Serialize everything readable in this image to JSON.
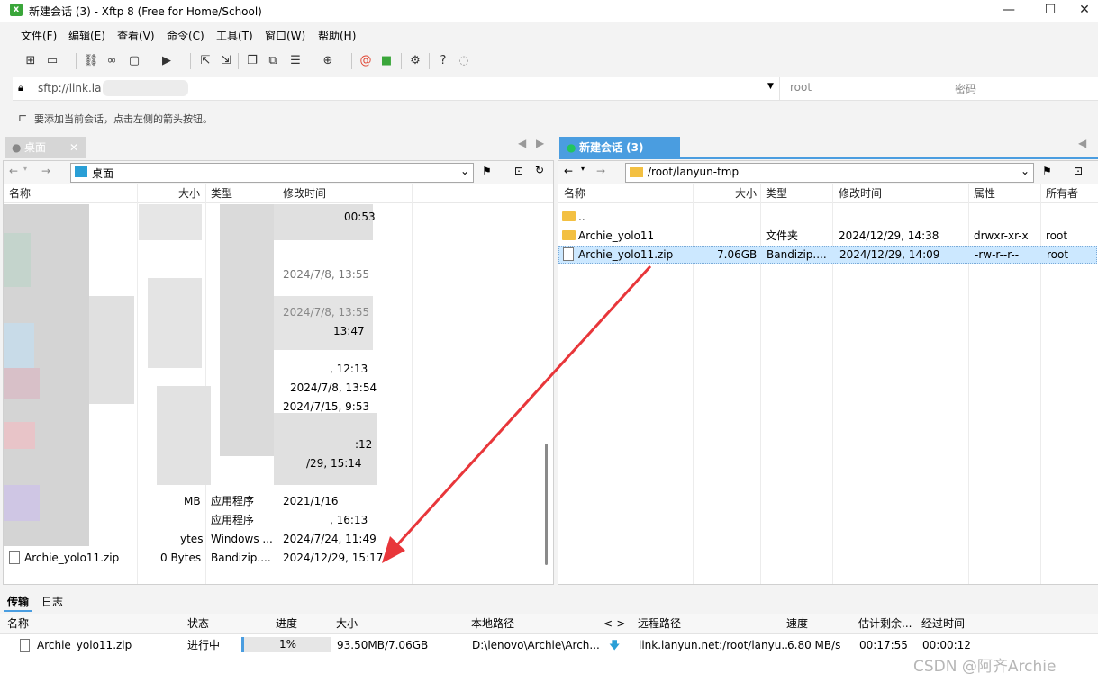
{
  "window": {
    "title": "新建会话 (3) - Xftp 8 (Free for Home/School)",
    "app_icon": "xftp-icon"
  },
  "menu": [
    "文件(F)",
    "编辑(E)",
    "查看(V)",
    "命令(C)",
    "工具(T)",
    "窗口(W)",
    "帮助(H)"
  ],
  "address": {
    "url": "sftp://link.la",
    "user_placeholder": "root",
    "password_placeholder": "密码"
  },
  "info_text": "要添加当前会话，点击左侧的箭头按钮。",
  "left_pane": {
    "tab_label": "桌面",
    "path": "桌面",
    "columns": [
      "名称",
      "大小",
      "类型",
      "修改时间"
    ],
    "visible_fragments": {
      "t1": "00:53",
      "t2": "2024/7/8, 13:55",
      "t3": "2024/7/8, 13:55",
      "t4": "13:47",
      "t5": ", 12:13",
      "t6": "2024/7/8, 13:54",
      "t7": "2024/7/15, 9:53",
      "t8": ":12",
      "t9": "/29, 15:14",
      "s1": "MB",
      "type1": "应用程序",
      "d1": "2021/1/16",
      "type2": "应用程序",
      "d2": ", 16:13",
      "s2": "ytes",
      "type3": "Windows ...",
      "d3": "2024/7/24, 11:49"
    },
    "rows": [
      {
        "name": "Archie_yolo11.zip",
        "size": "0 Bytes",
        "type": "Bandizip....",
        "modified": "2024/12/29, 15:17"
      }
    ]
  },
  "right_pane": {
    "tab_label": "新建会话 (3)",
    "path": "/root/lanyun-tmp",
    "columns": [
      "名称",
      "大小",
      "类型",
      "修改时间",
      "属性",
      "所有者"
    ],
    "rows": [
      {
        "name": "..",
        "size": "",
        "type": "",
        "modified": "",
        "attr": "",
        "owner": ""
      },
      {
        "name": "Archie_yolo11",
        "size": "",
        "type": "文件夹",
        "modified": "2024/12/29, 14:38",
        "attr": "drwxr-xr-x",
        "owner": "root"
      },
      {
        "name": "Archie_yolo11.zip",
        "size": "7.06GB",
        "type": "Bandizip....",
        "modified": "2024/12/29, 14:09",
        "attr": "-rw-r--r--",
        "owner": "root"
      }
    ]
  },
  "bottom_tabs": [
    "传输",
    "日志"
  ],
  "transfer": {
    "columns": [
      "名称",
      "状态",
      "进度",
      "大小",
      "本地路径",
      "<->",
      "远程路径",
      "速度",
      "估计剩余...",
      "经过时间"
    ],
    "rows": [
      {
        "name": "Archie_yolo11.zip",
        "status": "进行中",
        "progress": "1%",
        "progress_fraction": 0.01,
        "size": "93.50MB/7.06GB",
        "local": "D:\\lenovo\\Archie\\Arch...",
        "remote": "link.lanyun.net:/root/lanyu...",
        "speed": "6.80 MB/s",
        "eta": "00:17:55",
        "elapsed": "00:00:12"
      }
    ]
  },
  "watermark": "CSDN @阿齐Archie",
  "colors": {
    "accent": "#4a9de0",
    "selection": "#cce8ff",
    "annotation_arrow": "#e8363a",
    "session_dot": "#22c55e"
  }
}
